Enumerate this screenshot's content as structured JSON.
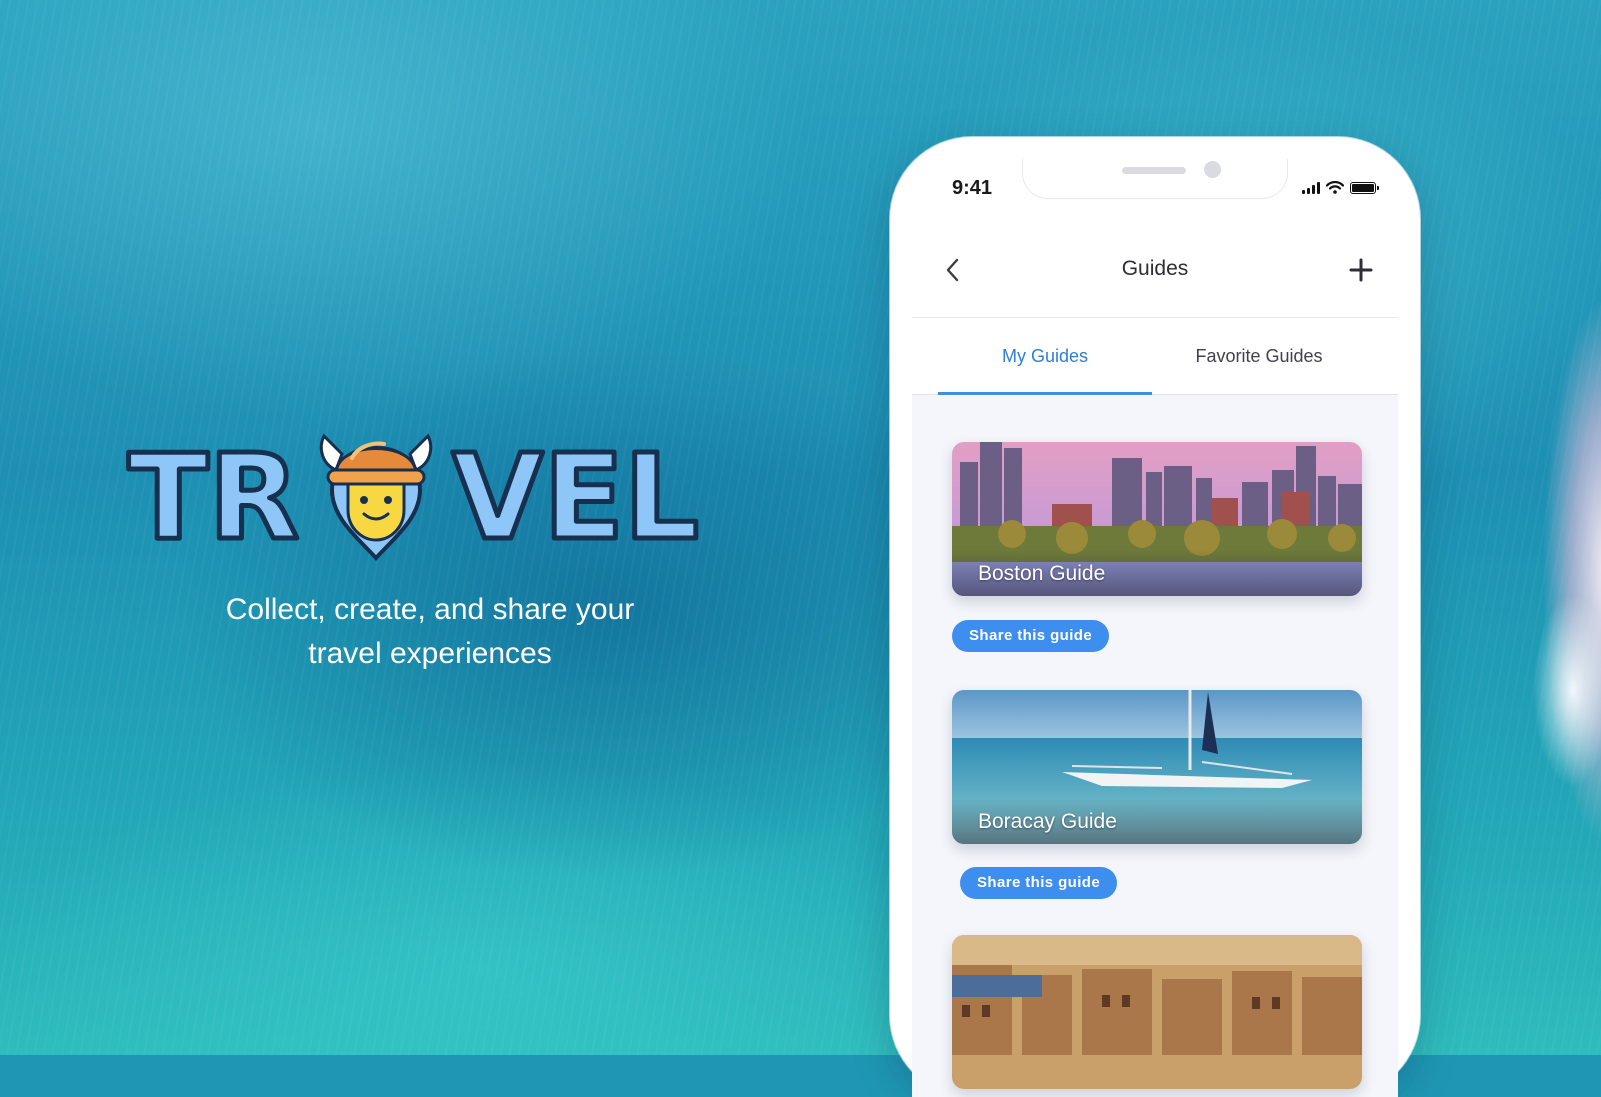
{
  "logo": {
    "wordmark": "TRAVEL",
    "letters_left": "TR",
    "letters_right": "VEL"
  },
  "tagline": {
    "line1": "Collect, create, and share your",
    "line2": "travel experiences"
  },
  "status_bar": {
    "time": "9:41",
    "icons": [
      "signal-icon",
      "wifi-icon",
      "battery-icon"
    ]
  },
  "nav": {
    "title": "Guides",
    "back_icon": "chevron-left-icon",
    "add_icon": "plus-icon"
  },
  "tabs": [
    {
      "label": "My Guides",
      "active": true
    },
    {
      "label": "Favorite Guides",
      "active": false
    }
  ],
  "guides": [
    {
      "title": "Boston Guide",
      "share_label": "Share this guide"
    },
    {
      "title": "Boracay Guide",
      "share_label": "Share this guide"
    },
    {
      "title": "",
      "share_label": ""
    }
  ],
  "colors": {
    "accent": "#3e8ef0",
    "tab_active": "#2f7fd8",
    "logo_fill": "#8ec7f7",
    "logo_outline": "#17304f",
    "hat": "#e58a3a",
    "face": "#f7d843"
  }
}
